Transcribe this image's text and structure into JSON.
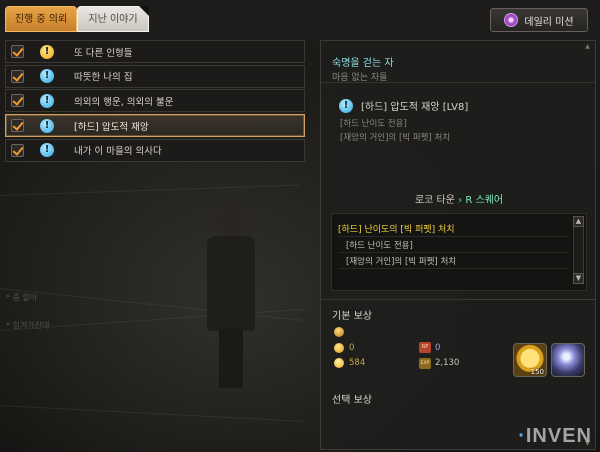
{
  "tabs": [
    {
      "label": "진행 중 의뢰",
      "active": true
    },
    {
      "label": "지난 이야기",
      "active": false
    }
  ],
  "daily_mission_label": "데일리 미션",
  "quests": [
    {
      "title": "또 다른 인형들",
      "checked": true,
      "type": "main"
    },
    {
      "title": "따뜻한 나의 집",
      "checked": true,
      "type": "side"
    },
    {
      "title": "의외의 행운, 의외의 불운",
      "checked": true,
      "type": "side"
    },
    {
      "title": "[하드] 압도적 재앙",
      "checked": true,
      "type": "side",
      "selected": true
    },
    {
      "title": "내가 이 마을의 의사다",
      "checked": true,
      "type": "side"
    }
  ],
  "background_notes": [
    "* 중 할아",
    "* 힘겨가찬대"
  ],
  "detail": {
    "npc_name": "숙명을 걷는 자",
    "npc_subtitle": "마음 없는 자들",
    "quest_title": "[하드] 압도적 재앙 [LV8]",
    "quest_lines": [
      "[하드 난이도 전용]",
      "[재앙의 거인]의 [빅 퍼펫] 처치"
    ],
    "location_from": "로코 타운",
    "location_arrow": "›",
    "location_to": "R 스퀘어",
    "objective_title": "[하드] 난이도의 [빅 퍼펫] 처치",
    "objective_lines": [
      "[하드 난이도 전용]",
      "[재앙의 거인]의 [빅 퍼펫] 처치"
    ],
    "basic_reward_label": "기본 보상",
    "rewards": {
      "gold_1": "0",
      "gold_2": "584",
      "rp_icon": "RP",
      "rp": "0",
      "exp_icon": "EXP",
      "exp": "2,130"
    },
    "item_slots": [
      {
        "icon": "gold-coin-bag-icon",
        "count": "150"
      },
      {
        "icon": "crystal-shard-icon",
        "count": ""
      }
    ],
    "select_reward_label": "선택 보상"
  },
  "watermark": "INVEN"
}
